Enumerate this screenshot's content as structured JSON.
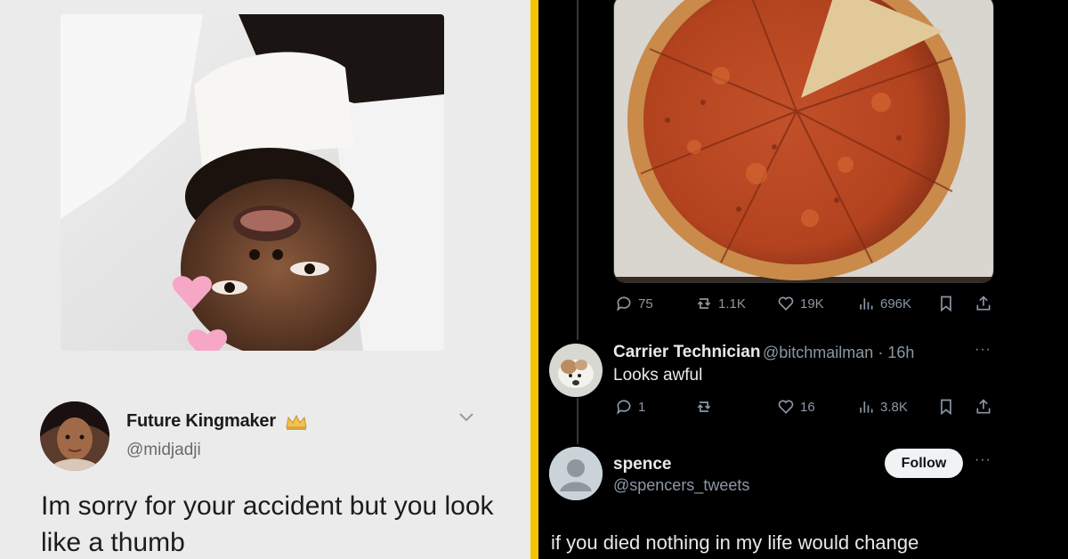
{
  "left_tweet": {
    "author_name": "Future Kingmaker",
    "author_handle": "@midjadji",
    "text": "Im sorry for your accident but you look like a thumb",
    "icons": [
      "crown-icon",
      "chevron-down-icon"
    ]
  },
  "right_main_tweet": {
    "metrics": {
      "replies": "75",
      "reposts": "1.1K",
      "likes": "19K",
      "views": "696K"
    },
    "icons": [
      "reply-icon",
      "repost-icon",
      "like-icon",
      "views-icon",
      "bookmark-icon",
      "share-icon"
    ]
  },
  "reply_1": {
    "author_name": "Carrier Technician",
    "author_handle": "@bitchmailman",
    "time": "16h",
    "text": "Looks awful",
    "metrics": {
      "replies": "1",
      "reposts": "",
      "likes": "16",
      "views": "3.8K"
    },
    "more": "···"
  },
  "reply_2": {
    "author_name": "spence",
    "author_handle": "@spencers_tweets",
    "follow_label": "Follow",
    "more": "···",
    "text": "if you died nothing in my life would change"
  },
  "colors": {
    "divider": "#f5c400",
    "dark_bg": "#000000",
    "light_bg": "#ebebeb",
    "muted_text": "#8b98a5"
  }
}
